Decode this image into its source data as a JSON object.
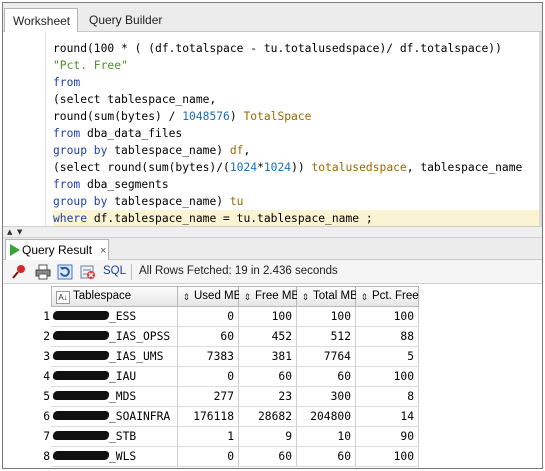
{
  "tabs": {
    "worksheet": "Worksheet",
    "query_builder": "Query Builder"
  },
  "editor": {
    "lines": [
      [
        {
          "t": "plain",
          "v": "       "
        },
        {
          "t": "plain",
          "v": ""
        }
      ],
      [
        {
          "t": "plain",
          "v": "round(100 * ( (df.totalspace - tu.totalusedspace)/ df.totalspace))"
        }
      ],
      [
        {
          "t": "str",
          "v": "\"Pct. Free\""
        }
      ],
      [
        {
          "t": "kw",
          "v": "from"
        }
      ],
      [
        {
          "t": "plain",
          "v": "(select tablespace_name,"
        }
      ],
      [
        {
          "t": "plain",
          "v": "round(sum(bytes) / "
        },
        {
          "t": "num",
          "v": "1048576"
        },
        {
          "t": "plain",
          "v": ") "
        },
        {
          "t": "id",
          "v": "TotalSpace"
        }
      ],
      [
        {
          "t": "kw",
          "v": "from"
        },
        {
          "t": "plain",
          "v": " dba_data_files"
        }
      ],
      [
        {
          "t": "kw",
          "v": "group by"
        },
        {
          "t": "plain",
          "v": " tablespace_name) "
        },
        {
          "t": "id",
          "v": "df"
        },
        {
          "t": "plain",
          "v": ","
        }
      ],
      [
        {
          "t": "plain",
          "v": "(select round(sum(bytes)/("
        },
        {
          "t": "num",
          "v": "1024"
        },
        {
          "t": "plain",
          "v": "*"
        },
        {
          "t": "num",
          "v": "1024"
        },
        {
          "t": "plain",
          "v": ")) "
        },
        {
          "t": "id",
          "v": "totalusedspace"
        },
        {
          "t": "plain",
          "v": ", tablespace_name"
        }
      ],
      [
        {
          "t": "kw",
          "v": "from"
        },
        {
          "t": "plain",
          "v": " dba_segments"
        }
      ],
      [
        {
          "t": "kw",
          "v": "group by"
        },
        {
          "t": "plain",
          "v": " tablespace_name) "
        },
        {
          "t": "id",
          "v": "tu"
        }
      ],
      [
        {
          "t": "kw",
          "v": "where"
        },
        {
          "t": "plain",
          "v": " df.tablespace_name = tu.tablespace_name ;"
        }
      ]
    ],
    "highlighted_line": 11
  },
  "result_tab": {
    "label": "Query Result",
    "close": "×"
  },
  "toolbar": {
    "sql_label": "SQL",
    "status": "All Rows Fetched: 19 in 2.436 seconds"
  },
  "grid": {
    "columns": [
      "Tablespace",
      "Used MB",
      "Free MB",
      "Total MB",
      "Pct. Free"
    ],
    "rows": [
      {
        "n": "1",
        "name": "_ESS",
        "used": "0",
        "free": "100",
        "total": "100",
        "pct": "100"
      },
      {
        "n": "2",
        "name": "_IAS_OPSS",
        "used": "60",
        "free": "452",
        "total": "512",
        "pct": "88"
      },
      {
        "n": "3",
        "name": "_IAS_UMS",
        "used": "7383",
        "free": "381",
        "total": "7764",
        "pct": "5"
      },
      {
        "n": "4",
        "name": "_IAU",
        "used": "0",
        "free": "60",
        "total": "60",
        "pct": "100"
      },
      {
        "n": "5",
        "name": "_MDS",
        "used": "277",
        "free": "23",
        "total": "300",
        "pct": "8"
      },
      {
        "n": "6",
        "name": "_SOAINFRA",
        "used": "176118",
        "free": "28682",
        "total": "204800",
        "pct": "14"
      },
      {
        "n": "7",
        "name": "_STB",
        "used": "1",
        "free": "9",
        "total": "10",
        "pct": "90"
      },
      {
        "n": "8",
        "name": "_WLS",
        "used": "0",
        "free": "60",
        "total": "60",
        "pct": "100"
      }
    ]
  },
  "colors": {
    "keyword": "#1f3fa8",
    "identifier": "#9a6a00",
    "string": "#4f8f2c",
    "number": "#1b6fb7",
    "current_line": "#fbf4d2"
  }
}
